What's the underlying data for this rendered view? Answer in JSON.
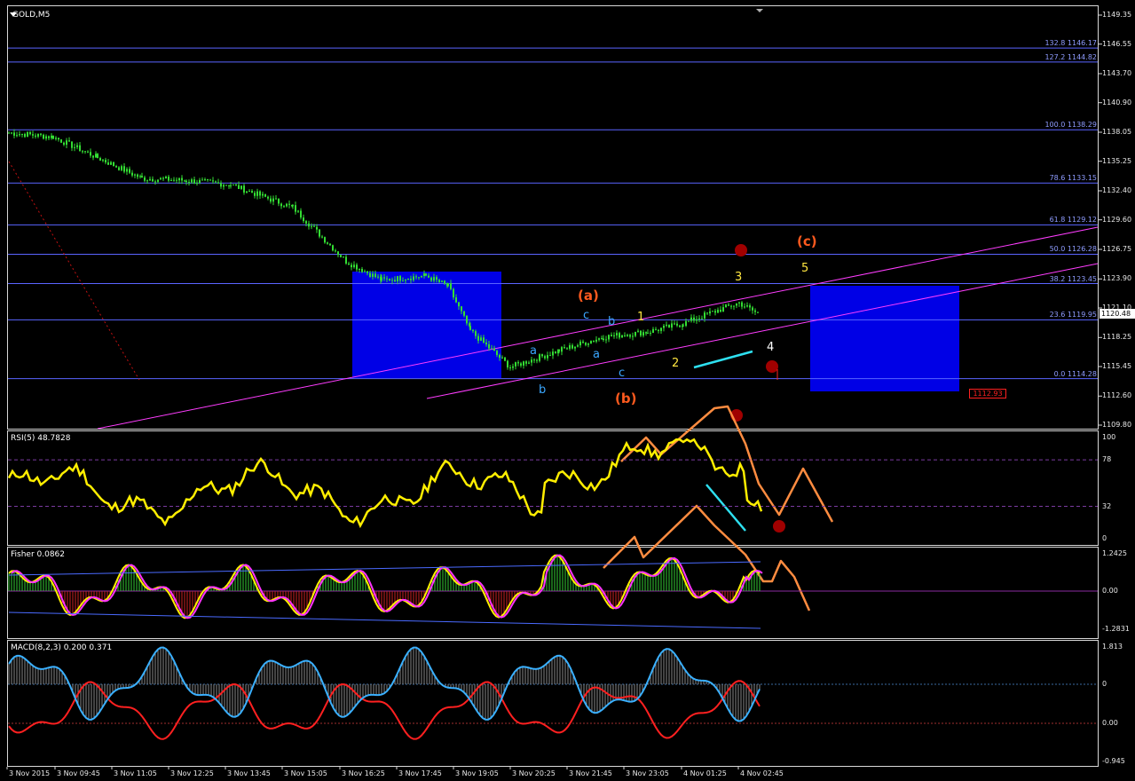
{
  "window": {
    "symbol_title": "GOLD,M5"
  },
  "indicators": {
    "rsi_title": "RSI(5) 48.7828",
    "fisher_title": "Fisher 0.0862",
    "macd_title": "MACD(8,2,3) 0.200 0.371"
  },
  "price_axis": {
    "ticks": [
      "1149.35",
      "1146.55",
      "1143.70",
      "1140.90",
      "1138.05",
      "1135.25",
      "1132.40",
      "1129.60",
      "1126.75",
      "1123.90",
      "1121.10",
      "1118.25",
      "1115.45",
      "1112.60",
      "1109.80"
    ],
    "current_price": "1120.48",
    "stop_label": "1112.93"
  },
  "rsi_axis": {
    "ticks": [
      "100",
      "78",
      "32",
      "0"
    ]
  },
  "fisher_axis": {
    "ticks": [
      "1.2425",
      "0.00",
      "-1.2831"
    ]
  },
  "macd_axis": {
    "ticks": [
      "1.813",
      "0",
      "0.00",
      "-0.945"
    ]
  },
  "time_axis": {
    "ticks": [
      "3 Nov 2015",
      "3 Nov 09:45",
      "3 Nov 11:05",
      "3 Nov 12:25",
      "3 Nov 13:45",
      "3 Nov 15:05",
      "3 Nov 16:25",
      "3 Nov 17:45",
      "3 Nov 19:05",
      "3 Nov 20:25",
      "3 Nov 21:45",
      "3 Nov 23:05",
      "4 Nov 01:25",
      "4 Nov 02:45"
    ]
  },
  "fib_levels": [
    {
      "label": "132.8 1146.17",
      "price": 1146.17
    },
    {
      "label": "127.2 1144.82",
      "price": 1144.82
    },
    {
      "label": "100.0 1138.29",
      "price": 1138.29
    },
    {
      "label": "78.6 1133.15",
      "price": 1133.15
    },
    {
      "label": "61.8 1129.12",
      "price": 1129.12
    },
    {
      "label": "50.0 1126.28",
      "price": 1126.28
    },
    {
      "label": "38.2 1123.45",
      "price": 1123.45
    },
    {
      "label": "23.6 1119.95",
      "price": 1119.95
    },
    {
      "label": "0.0 1114.28",
      "price": 1114.28
    }
  ],
  "wave_labels": [
    {
      "text": "(a)",
      "color": "#ff5a1e"
    },
    {
      "text": "(b)",
      "color": "#ff5a1e"
    },
    {
      "text": "(c)",
      "color": "#ff5a1e"
    },
    {
      "text": "a",
      "color": "#3aa7ff"
    },
    {
      "text": "b",
      "color": "#3aa7ff"
    },
    {
      "text": "c",
      "color": "#3aa7ff"
    },
    {
      "text": "a",
      "color": "#3aa7ff"
    },
    {
      "text": "b",
      "color": "#3aa7ff"
    },
    {
      "text": "c",
      "color": "#3aa7ff"
    },
    {
      "text": "1",
      "color": "#ffe640"
    },
    {
      "text": "2",
      "color": "#ffe640"
    },
    {
      "text": "3",
      "color": "#ffe640"
    },
    {
      "text": "4",
      "color": "#ffffff"
    },
    {
      "text": "5",
      "color": "#ffe640"
    }
  ],
  "colors": {
    "candles": "#33dd33",
    "fib": "#5a64ff",
    "channel": "#ff3dff",
    "zone": "#0000e6",
    "rsi": "#ffee00",
    "fisher_main": "#ffee00",
    "fisher_signal": "#ff33ff",
    "macd_main": "#3ab0ff",
    "macd_signal": "#ff2020",
    "arrow_orange": "#ff8c40",
    "arrow_cyan": "#2ee0f0"
  },
  "chart_data": {
    "type": "candlestick",
    "title": "GOLD,M5",
    "xlabel": "",
    "ylabel": "",
    "ylim": [
      1109.8,
      1149.35
    ],
    "x": [
      "3 Nov 2015",
      "3 Nov 09:45",
      "3 Nov 11:05",
      "3 Nov 12:25",
      "3 Nov 13:45",
      "3 Nov 15:05",
      "3 Nov 16:25",
      "3 Nov 17:45",
      "3 Nov 19:05",
      "3 Nov 20:25",
      "3 Nov 21:45",
      "3 Nov 23:05",
      "4 Nov 01:25",
      "4 Nov 02:45"
    ],
    "series": [
      {
        "values": [
          1138.0,
          1137.6,
          1135.6,
          1133.6,
          1133.4,
          1133.0,
          1130.8,
          1125.6,
          1123.8,
          1124.2,
          1123.2,
          1118.9,
          1115.4,
          1117.0,
          1118.3,
          1118.8,
          1119.6,
          1120.6,
          1121.6,
          1120.4
        ]
      }
    ]
  }
}
